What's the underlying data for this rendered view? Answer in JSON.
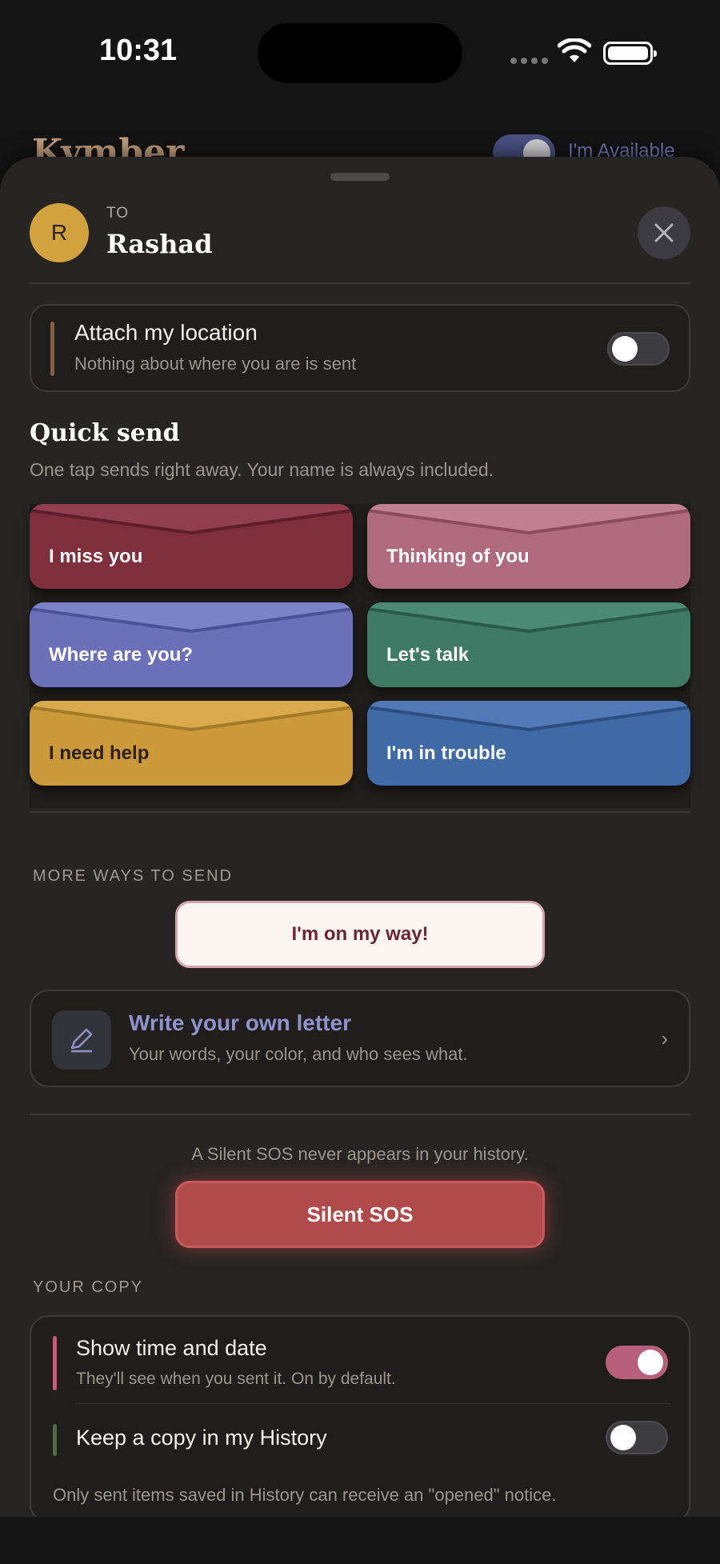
{
  "status_bar": {
    "time": "10:31"
  },
  "background_app": {
    "title": "Kymber",
    "availability_label": "I'm Available",
    "availability_on": true
  },
  "recipient": {
    "to_label": "TO",
    "initial": "R",
    "name": "Rashad"
  },
  "location": {
    "title": "Attach my location",
    "subtitle": "Nothing about where you are is sent",
    "enabled": false
  },
  "quick_send": {
    "title": "Quick send",
    "subtitle": "One tap sends right away. Your name is always included.",
    "items": [
      {
        "label": "I miss you",
        "color": "#7f2e3c"
      },
      {
        "label": "Thinking of you",
        "color": "#b06a80"
      },
      {
        "label": "Where are you?",
        "color": "#6b70b9"
      },
      {
        "label": "Let's talk",
        "color": "#3e7a66"
      },
      {
        "label": "I need help",
        "color": "#cc9a3a"
      },
      {
        "label": "I'm in trouble",
        "color": "#3f6aa6"
      }
    ]
  },
  "more_ways": {
    "label": "MORE WAYS TO SEND",
    "on_my_way": "I'm on my way!"
  },
  "write_letter": {
    "title": "Write your own letter",
    "subtitle": "Your words, your color, and who sees what.",
    "chevron": "›"
  },
  "sos": {
    "note": "A Silent SOS never appears in your history.",
    "button": "Silent SOS"
  },
  "your_copy": {
    "label": "YOUR COPY",
    "show_time": {
      "title": "Show time and date",
      "subtitle": "They'll see when you sent it. On by default.",
      "enabled": true
    },
    "keep_copy": {
      "title": "Keep a copy in my History",
      "enabled": false
    },
    "footnote": "Only sent items saved in History can receive an \"opened\" notice."
  }
}
